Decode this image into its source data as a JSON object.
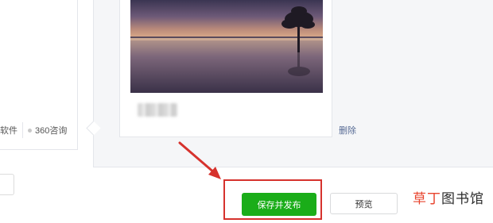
{
  "left_panel": {
    "tag_software": "软件",
    "tag_consult": "360咨询"
  },
  "article": {
    "delete_label": "删除"
  },
  "actions": {
    "publish_label": "保存并发布",
    "preview_label": "预览"
  },
  "watermark": {
    "part1": "草丁",
    "part2": "图书馆"
  },
  "colors": {
    "primary_green": "#1aad19",
    "highlight_red": "#d6322d",
    "link_blue": "#576b95"
  }
}
